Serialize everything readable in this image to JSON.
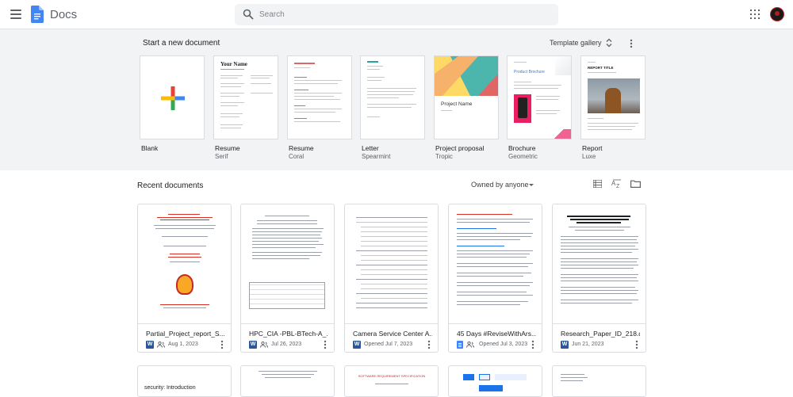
{
  "app": {
    "title": "Docs"
  },
  "search": {
    "placeholder": "Search"
  },
  "templates": {
    "heading": "Start a new document",
    "gallery_label": "Template gallery",
    "items": [
      {
        "name": "Blank",
        "sub": ""
      },
      {
        "name": "Resume",
        "sub": "Serif"
      },
      {
        "name": "Resume",
        "sub": "Coral"
      },
      {
        "name": "Letter",
        "sub": "Spearmint"
      },
      {
        "name": "Project proposal",
        "sub": "Tropic"
      },
      {
        "name": "Brochure",
        "sub": "Geometric"
      },
      {
        "name": "Report",
        "sub": "Luxe"
      }
    ],
    "thumb_text": {
      "resume_name": "Your Name",
      "project_name": "Project Name",
      "brochure_title": "Product Brochure",
      "report_title": "REPORT TITLE"
    }
  },
  "recent": {
    "heading": "Recent documents",
    "owner_filter": "Owned by anyone",
    "docs": [
      {
        "title": "Partial_Project_report_S...",
        "type": "word",
        "date": "Aug 1, 2023",
        "shared": true
      },
      {
        "title": "HPC_CIA -PBL-BTech-A_...",
        "type": "word",
        "date": "Jul 26, 2023",
        "shared": true
      },
      {
        "title": "Camera Service Center A...",
        "type": "word",
        "date": "Opened Jul 7, 2023",
        "shared": false
      },
      {
        "title": "45 Days #ReviseWithArs...",
        "type": "docs",
        "date": "Opened Jul 3, 2023",
        "shared": true
      },
      {
        "title": "Research_Paper_ID_218.d...",
        "type": "word",
        "date": "Jun 21, 2023",
        "shared": false
      }
    ],
    "second_row_text": [
      "security: Introduction",
      "SOFTWARE REQUIREMENT SPECIFICATION"
    ]
  },
  "colors": {
    "accent": "#4285f4",
    "word_blue": "#2b579a",
    "background_band": "#f1f3f4"
  }
}
